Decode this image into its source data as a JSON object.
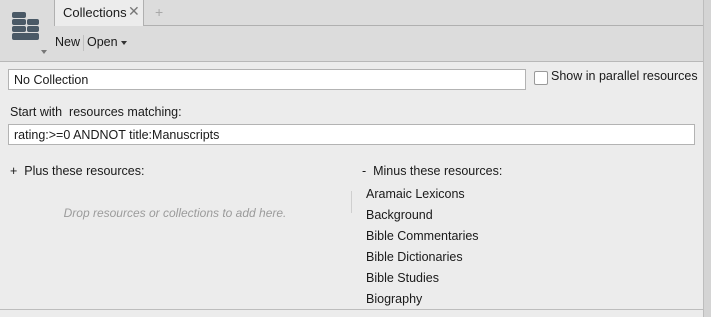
{
  "tabs": [
    {
      "label": "Collections"
    }
  ],
  "toolbar": {
    "new_label": "New",
    "open_label": "Open"
  },
  "collection": {
    "name_value": "No Collection",
    "parallel_label": "Show in parallel resources",
    "parallel_checked": false
  },
  "filter": {
    "label": "Start with  resources matching:",
    "query_value": "rating:>=0 ANDNOT title:Manuscripts"
  },
  "plus": {
    "header": "+  Plus these resources:",
    "hint": "Drop resources or collections to add here."
  },
  "minus": {
    "header": "-  Minus these resources:",
    "items": [
      "Aramaic Lexicons",
      "Background",
      "Bible Commentaries",
      "Bible Dictionaries",
      "Bible Studies",
      "Biography"
    ]
  },
  "colors": {
    "accent_icon": "#4a5966",
    "panel_bg": "#ececec",
    "chrome_bg": "#dcdcdc"
  }
}
